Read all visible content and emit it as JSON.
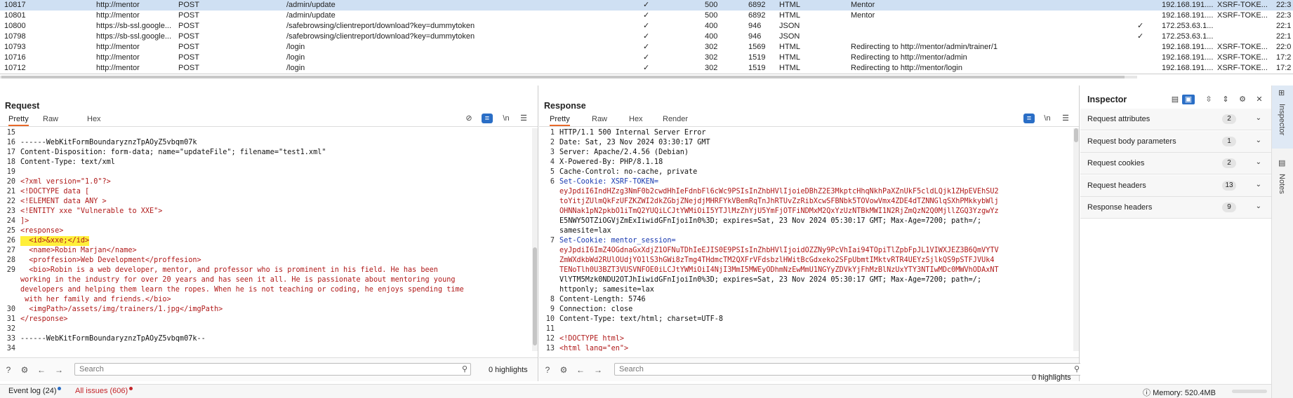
{
  "proxy_rows": [
    {
      "id": "10817",
      "host": "http://mentor",
      "method": "POST",
      "url": "/admin/update",
      "edited": "✓",
      "status": "500",
      "length": "6892",
      "mime": "HTML",
      "title": "Mentor",
      "check": "",
      "ip": "192.168.191....",
      "cookie": "XSRF-TOKE...",
      "time": "22:3",
      "selected": true
    },
    {
      "id": "10801",
      "host": "http://mentor",
      "method": "POST",
      "url": "/admin/update",
      "edited": "✓",
      "status": "500",
      "length": "6892",
      "mime": "HTML",
      "title": "Mentor",
      "check": "",
      "ip": "192.168.191....",
      "cookie": "XSRF-TOKE...",
      "time": "22:3"
    },
    {
      "id": "10800",
      "host": "https://sb-ssl.google...",
      "method": "POST",
      "url": "/safebrowsing/clientreport/download?key=dummytoken",
      "edited": "✓",
      "status": "400",
      "length": "946",
      "mime": "JSON",
      "title": "",
      "check": "✓",
      "ip": "172.253.63.1...",
      "cookie": "",
      "time": "22:1"
    },
    {
      "id": "10798",
      "host": "https://sb-ssl.google...",
      "method": "POST",
      "url": "/safebrowsing/clientreport/download?key=dummytoken",
      "edited": "✓",
      "status": "400",
      "length": "946",
      "mime": "JSON",
      "title": "",
      "check": "✓",
      "ip": "172.253.63.1...",
      "cookie": "",
      "time": "22:1"
    },
    {
      "id": "10793",
      "host": "http://mentor",
      "method": "POST",
      "url": "/login",
      "edited": "✓",
      "status": "302",
      "length": "1569",
      "mime": "HTML",
      "title": "Redirecting to http://mentor/admin/trainer/1",
      "check": "",
      "ip": "192.168.191....",
      "cookie": "XSRF-TOKE...",
      "time": "22:0"
    },
    {
      "id": "10716",
      "host": "http://mentor",
      "method": "POST",
      "url": "/login",
      "edited": "✓",
      "status": "302",
      "length": "1519",
      "mime": "HTML",
      "title": "Redirecting to http://mentor/admin",
      "check": "",
      "ip": "192.168.191....",
      "cookie": "XSRF-TOKE...",
      "time": "17:2"
    },
    {
      "id": "10712",
      "host": "http://mentor",
      "method": "POST",
      "url": "/login",
      "edited": "✓",
      "status": "302",
      "length": "1519",
      "mime": "HTML",
      "title": "Redirecting to http://mentor/login",
      "check": "",
      "ip": "192.168.191....",
      "cookie": "XSRF-TOKE...",
      "time": "17:2"
    }
  ],
  "request": {
    "title": "Request",
    "tabs": [
      "Pretty",
      "Raw",
      "Hex"
    ],
    "lines": [
      {
        "n": "15",
        "t": ""
      },
      {
        "n": "16",
        "t": "------WebKitFormBoundaryznzTpAOyZ5vbqm07k"
      },
      {
        "n": "17",
        "t": "Content-Disposition: form-data; name=\"updateFile\"; filename=\"test1.xml\""
      },
      {
        "n": "18",
        "t": "Content-Type: text/xml"
      },
      {
        "n": "19",
        "t": ""
      },
      {
        "n": "20",
        "t": "<?xml version=\"1.0\"?>",
        "c": "red"
      },
      {
        "n": "21",
        "t": "<!DOCTYPE data [",
        "c": "red"
      },
      {
        "n": "22",
        "t": "<!ELEMENT data ANY >",
        "c": "red"
      },
      {
        "n": "23",
        "t": "<!ENTITY xxe \"Vulnerable to XXE\">",
        "c": "red"
      },
      {
        "n": "24",
        "t": "]>",
        "c": "red"
      },
      {
        "n": "25",
        "t": "<response>",
        "c": "red"
      },
      {
        "n": "26",
        "t": "  <id>&xxe;</id>",
        "c": "red",
        "hl": true
      },
      {
        "n": "27",
        "t": "  <name>Robin Marjan</name>",
        "c": "red"
      },
      {
        "n": "28",
        "t": "  <proffesion>Web Development</proffesion>",
        "c": "red"
      },
      {
        "n": "29",
        "t": "  <bio>Robin is a web developer, mentor, and professor who is prominent in his field. He has been",
        "c": "red"
      },
      {
        "n": "",
        "t": "working in the industry for over 20 years and has seen it all. He is passionate about mentoring young",
        "c": "red"
      },
      {
        "n": "",
        "t": "developers and helping them learn the ropes. When he is not teaching or coding, he enjoys spending time",
        "c": "red"
      },
      {
        "n": "",
        "t": " with her family and friends.</bio>",
        "c": "red"
      },
      {
        "n": "30",
        "t": "  <imgPath>/assets/img/trainers/1.jpg</imgPath>",
        "c": "red"
      },
      {
        "n": "31",
        "t": "</response>",
        "c": "red"
      },
      {
        "n": "32",
        "t": ""
      },
      {
        "n": "33",
        "t": "------WebKitFormBoundaryznzTpAOyZ5vbqm07k--"
      },
      {
        "n": "34",
        "t": ""
      }
    ],
    "search_placeholder": "Search",
    "highlights": "0 highlights"
  },
  "response": {
    "title": "Response",
    "tabs": [
      "Pretty",
      "Raw",
      "Hex",
      "Render"
    ],
    "lines": [
      {
        "n": "1",
        "t": "HTTP/1.1 500 Internal Server Error"
      },
      {
        "n": "2",
        "t": "Date: Sat, 23 Nov 2024 03:30:17 GMT"
      },
      {
        "n": "3",
        "t": "Server: Apache/2.4.56 (Debian)"
      },
      {
        "n": "4",
        "t": "X-Powered-By: PHP/8.1.18"
      },
      {
        "n": "5",
        "t": "Cache-Control: no-cache, private"
      },
      {
        "n": "6",
        "t": "Set-Cookie: XSRF-TOKEN=",
        "c": "blue"
      },
      {
        "n": "",
        "t": "eyJpdiI6IndHZzg3NmF0b2cwdHhIeFdnbFl6cWc9PSIsInZhbHVlIjoieDBhZ2E3MkptcHhqNkhPaXZnUkF5cldLQjk1ZHpEVEhSU2",
        "c": "red"
      },
      {
        "n": "",
        "t": "toYitjZUlmQkFzUFZKZWI2dkZGbjZNejdjMHRFYkVBemRqTnJhRTUvZzRibXcwSFBNbk5TOVowVmx4ZDE4dTZNNGlqSXhPMkkybWlj",
        "c": "red"
      },
      {
        "n": "",
        "t": "OHNNak1pN2pkbO1iTmQ2YUQiLCJtYWMiOiI5YTJlMzZhYjU5YmFjOTFiNDMxM2QxYzUzNTBkMWI1N2RjZmQzN2Q0MjllZGQ3YzgwYz",
        "c": "red"
      },
      {
        "n": "",
        "t": "E5NWY5OTZiOGVjZmExIiwidGFnIjoiIn0%3D; expires=Sat, 23 Nov 2024 05:30:17 GMT; Max-Age=7200; path=/;"
      },
      {
        "n": "",
        "t": "samesite=lax"
      },
      {
        "n": "7",
        "t": "Set-Cookie: mentor_session=",
        "c": "blue"
      },
      {
        "n": "",
        "t": "eyJpdiI6ImZ4OGdnaGxXdjZ1OFNuTDhIeEJIS0E9PSIsInZhbHVlIjoidOZZNy9PcVhIai94TOpiTlZpbFpJL1VIWXJEZ3B6QmVYTV",
        "c": "red"
      },
      {
        "n": "",
        "t": "ZmWXdkbWd2RUlOUdjYO1lS3hGWi8zTmg4THdmcTM2QXFrVFdsbzlHWitBcGdxeko2SFpUbmtIMktvRTR4UEYzSjlkQS9pSTFJVUk4",
        "c": "red"
      },
      {
        "n": "",
        "t": "TENoTlh0U3BZT3VUSVNFOE0iLCJtYWMiOiI4NjI3MmI5MWEyODhmNzEwMmU1NGYyZDVkYjFhMzBlNzUxYTY3NTIwMDc0MWVhODAxNT",
        "c": "red"
      },
      {
        "n": "",
        "t": "VlYTM5Mzk0NDU2OTJhIiwidGFnIjoiIn0%3D; expires=Sat, 23 Nov 2024 05:30:17 GMT; Max-Age=7200; path=/;"
      },
      {
        "n": "",
        "t": "httponly; samesite=lax"
      },
      {
        "n": "8",
        "t": "Content-Length: 5746"
      },
      {
        "n": "9",
        "t": "Connection: close"
      },
      {
        "n": "10",
        "t": "Content-Type: text/html; charset=UTF-8"
      },
      {
        "n": "11",
        "t": ""
      },
      {
        "n": "12",
        "t": "<!DOCTYPE html>",
        "c": "red"
      },
      {
        "n": "13",
        "t": "<html lang=\"en\">",
        "c": "red"
      }
    ],
    "search_placeholder": "Search",
    "highlights": "0 highlights"
  },
  "inspector": {
    "title": "Inspector",
    "sections": [
      {
        "label": "Request attributes",
        "count": "2"
      },
      {
        "label": "Request body parameters",
        "count": "1"
      },
      {
        "label": "Request cookies",
        "count": "2"
      },
      {
        "label": "Request headers",
        "count": "13"
      },
      {
        "label": "Response headers",
        "count": "9"
      }
    ]
  },
  "sidebar": {
    "inspector": "Inspector",
    "notes": "Notes"
  },
  "status": {
    "event_log": "Event log (24)",
    "issues": "All issues (606)",
    "memory": "Memory: 520.4MB"
  },
  "colors": {
    "accent": "#e8692a",
    "selection": "#cfe0f3",
    "highlight": "#ffef3a",
    "blue": "#2a6ec6"
  }
}
